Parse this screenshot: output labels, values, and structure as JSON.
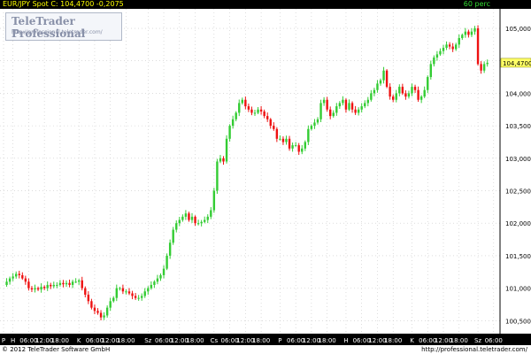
{
  "header": {
    "symbol_line": "EUR/JPY Spot C: 104,4700 -0,2075",
    "timeframe": "60 perc"
  },
  "watermark": {
    "title": "TeleTrader Professional",
    "url": "http://professional.teletrader.com/"
  },
  "footer": {
    "copyright": "© 2012 TeleTrader Software GmbH",
    "url": "http://professional.teletrader.com/"
  },
  "colors": {
    "up": "#33cc33",
    "down": "#ee1111",
    "grid": "#c8c8c8",
    "last_price_bg": "#ffff66",
    "top_bar": "#000000",
    "axis_bar": "#000000"
  },
  "chart_data": {
    "type": "candlestick",
    "title": "EUR/JPY Spot",
    "last_value": "104,4700",
    "change": "-0,2075",
    "ylim": [
      100.3,
      105.3
    ],
    "y_ticks": [
      "105,0000",
      "104,5000",
      "104,0000",
      "103,5000",
      "103,0000",
      "102,5000",
      "102,0000",
      "101,5000",
      "101,0000",
      "100,5000"
    ],
    "y_tick_values": [
      105.0,
      104.5,
      104.0,
      103.5,
      103.0,
      102.5,
      102.0,
      101.5,
      101.0,
      100.5
    ],
    "x_ticks": [
      {
        "label": "P",
        "index": 0
      },
      {
        "label": "H",
        "index": 3
      },
      {
        "label": "06:00",
        "index": 8
      },
      {
        "label": "12:00",
        "index": 13
      },
      {
        "label": "18:00",
        "index": 18
      },
      {
        "label": "K",
        "index": 24
      },
      {
        "label": "06:00",
        "index": 29
      },
      {
        "label": "12:00",
        "index": 34
      },
      {
        "label": "18:00",
        "index": 39
      },
      {
        "label": "Sz",
        "index": 46
      },
      {
        "label": "06:00",
        "index": 51
      },
      {
        "label": "12:00",
        "index": 56
      },
      {
        "label": "18:00",
        "index": 61
      },
      {
        "label": "Cs",
        "index": 67
      },
      {
        "label": "06:00",
        "index": 72
      },
      {
        "label": "12:00",
        "index": 77
      },
      {
        "label": "18:00",
        "index": 82
      },
      {
        "label": "P",
        "index": 88
      },
      {
        "label": "06:00",
        "index": 93
      },
      {
        "label": "12:00",
        "index": 98
      },
      {
        "label": "18:00",
        "index": 103
      },
      {
        "label": "H",
        "index": 109
      },
      {
        "label": "06:00",
        "index": 114
      },
      {
        "label": "12:00",
        "index": 119
      },
      {
        "label": "18:00",
        "index": 124
      },
      {
        "label": "K",
        "index": 130
      },
      {
        "label": "06:00",
        "index": 135
      },
      {
        "label": "12:00",
        "index": 140
      },
      {
        "label": "18:00",
        "index": 145
      },
      {
        "label": "Sz",
        "index": 151
      },
      {
        "label": "06:00",
        "index": 156
      }
    ],
    "close_path": [
      101.05,
      101.1,
      101.15,
      101.18,
      101.22,
      101.2,
      101.15,
      101.1,
      101.0,
      100.98,
      101.0,
      100.98,
      101.02,
      101.0,
      101.05,
      101.03,
      101.05,
      101.05,
      101.08,
      101.06,
      101.08,
      101.05,
      101.1,
      101.1,
      101.12,
      101.0,
      100.9,
      100.8,
      100.7,
      100.65,
      100.62,
      100.55,
      100.58,
      100.7,
      100.8,
      100.85,
      101.0,
      101.0,
      100.95,
      100.95,
      100.92,
      100.88,
      100.85,
      100.85,
      100.88,
      100.95,
      101.0,
      101.05,
      101.1,
      101.15,
      101.2,
      101.3,
      101.5,
      101.7,
      101.9,
      102.0,
      102.05,
      102.1,
      102.15,
      102.05,
      102.1,
      102.0,
      102.0,
      102.02,
      102.05,
      102.1,
      102.2,
      102.5,
      102.95,
      103.0,
      102.95,
      103.3,
      103.5,
      103.6,
      103.7,
      103.85,
      103.9,
      103.8,
      103.75,
      103.7,
      103.7,
      103.75,
      103.72,
      103.65,
      103.6,
      103.5,
      103.45,
      103.3,
      103.3,
      103.25,
      103.3,
      103.15,
      103.2,
      103.2,
      103.1,
      103.15,
      103.25,
      103.45,
      103.5,
      103.55,
      103.6,
      103.85,
      103.9,
      103.75,
      103.65,
      103.7,
      103.8,
      103.85,
      103.9,
      103.75,
      103.85,
      103.75,
      103.7,
      103.75,
      103.8,
      103.85,
      103.9,
      104.0,
      104.05,
      104.15,
      104.2,
      104.35,
      104.1,
      103.95,
      103.9,
      104.0,
      104.1,
      104.0,
      103.95,
      104.0,
      104.1,
      104.05,
      103.9,
      103.95,
      104.05,
      104.25,
      104.45,
      104.55,
      104.6,
      104.65,
      104.7,
      104.75,
      104.72,
      104.68,
      104.75,
      104.85,
      104.9,
      104.95,
      104.9,
      104.95,
      105.0,
      104.45,
      104.35,
      104.45,
      104.47
    ],
    "ylabel": "",
    "xlabel": ""
  }
}
